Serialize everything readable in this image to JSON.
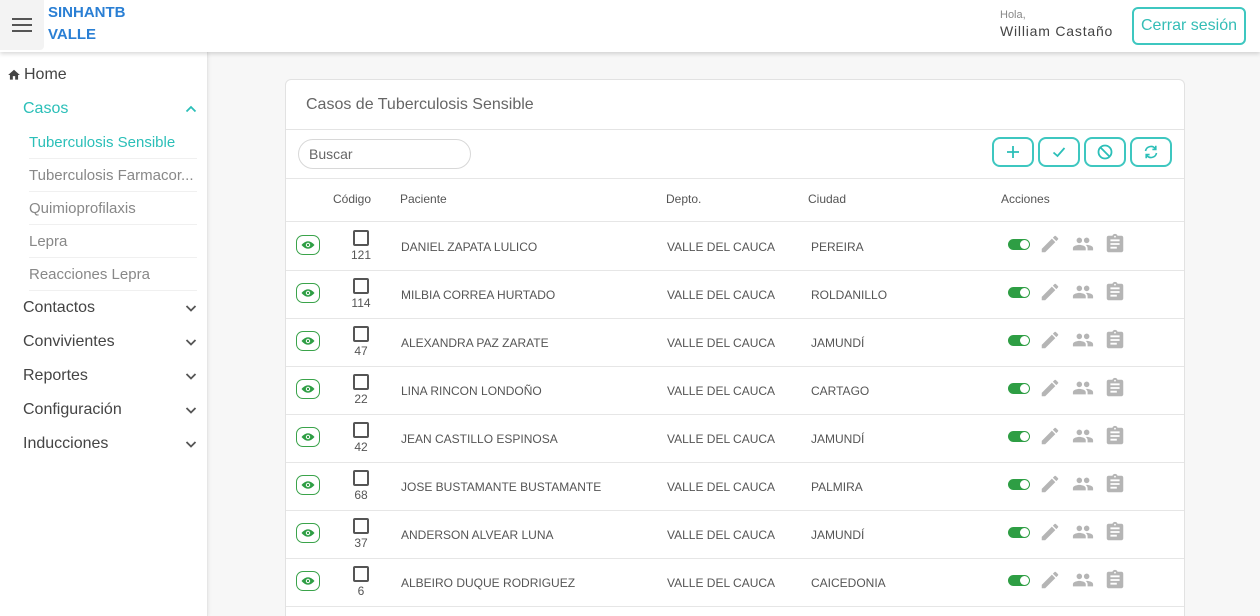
{
  "header": {
    "brand_line1": "SINHANTB",
    "brand_line2": "VALLE",
    "greeting": "Hola,",
    "user_name": "William Castaño",
    "logout_label": "Cerrar sesión"
  },
  "sidebar": {
    "home_label": "Home",
    "sections": [
      {
        "label": "Casos",
        "expanded": true,
        "items": [
          {
            "label": "Tuberculosis Sensible",
            "active": true
          },
          {
            "label": "Tuberculosis Farmacor..."
          },
          {
            "label": "Quimioprofilaxis"
          },
          {
            "label": "Lepra"
          },
          {
            "label": "Reacciones Lepra"
          }
        ]
      },
      {
        "label": "Contactos",
        "expanded": false
      },
      {
        "label": "Convivientes",
        "expanded": false
      },
      {
        "label": "Reportes",
        "expanded": false
      },
      {
        "label": "Configuración",
        "expanded": false
      },
      {
        "label": "Inducciones",
        "expanded": false
      }
    ]
  },
  "main": {
    "title": "Casos de Tuberculosis Sensible",
    "search_placeholder": "Buscar",
    "columns": {
      "codigo": "Código",
      "paciente": "Paciente",
      "depto": "Depto.",
      "ciudad": "Ciudad",
      "acciones": "Acciones"
    },
    "rows": [
      {
        "codigo": "121",
        "paciente": "DANIEL ZAPATA LULICO",
        "depto": "VALLE DEL CAUCA",
        "ciudad": "PEREIRA"
      },
      {
        "codigo": "114",
        "paciente": "MILBIA CORREA HURTADO",
        "depto": "VALLE DEL CAUCA",
        "ciudad": "ROLDANILLO"
      },
      {
        "codigo": "47",
        "paciente": "ALEXANDRA PAZ ZARATE",
        "depto": "VALLE DEL CAUCA",
        "ciudad": "JAMUNDÍ"
      },
      {
        "codigo": "22",
        "paciente": "LINA RINCON LONDOÑO",
        "depto": "VALLE DEL CAUCA",
        "ciudad": "CARTAGO"
      },
      {
        "codigo": "42",
        "paciente": "JEAN CASTILLO ESPINOSA",
        "depto": "VALLE DEL CAUCA",
        "ciudad": "JAMUNDÍ"
      },
      {
        "codigo": "68",
        "paciente": "JOSE BUSTAMANTE BUSTAMANTE",
        "depto": "VALLE DEL CAUCA",
        "ciudad": "PALMIRA"
      },
      {
        "codigo": "37",
        "paciente": "ANDERSON ALVEAR LUNA",
        "depto": "VALLE DEL CAUCA",
        "ciudad": "JAMUNDÍ"
      },
      {
        "codigo": "6",
        "paciente": "ALBEIRO DUQUE RODRIGUEZ",
        "depto": "VALLE DEL CAUCA",
        "ciudad": "CAICEDONIA"
      }
    ]
  },
  "colors": {
    "accent": "#2bbfb8",
    "brand": "#2a7fd4",
    "success": "#2e9e44",
    "icon_gray": "#b5b5b5"
  }
}
